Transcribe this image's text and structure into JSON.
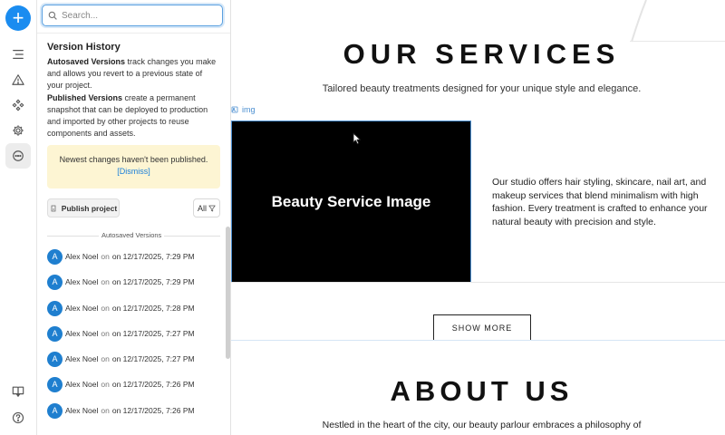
{
  "rail": {
    "add_label": "+"
  },
  "panel": {
    "search_placeholder": "Search...",
    "title": "Version History",
    "autosaved_term": "Autosaved Versions",
    "autosaved_desc": " track changes you make and allows you revert to a previous state of your project.",
    "published_term": "Published Versions",
    "published_desc": " create a permanent snapshot that can be deployed to production and imported by other projects to reuse components and assets.",
    "notice_text": "Newest changes haven't been published.",
    "notice_dismiss": "[Dismiss]",
    "publish_label": "Publish project",
    "filter_label": "All",
    "autosaved_section_label": "Autosaved Versions",
    "versions": [
      {
        "initial": "A",
        "author": "Alex Noel",
        "on": "on",
        "timestamp": "on 12/17/2025, 7:29 PM"
      },
      {
        "initial": "A",
        "author": "Alex Noel",
        "on": "on",
        "timestamp": "on 12/17/2025, 7:29 PM"
      },
      {
        "initial": "A",
        "author": "Alex Noel",
        "on": "on",
        "timestamp": "on 12/17/2025, 7:28 PM"
      },
      {
        "initial": "A",
        "author": "Alex Noel",
        "on": "on",
        "timestamp": "on 12/17/2025, 7:27 PM"
      },
      {
        "initial": "A",
        "author": "Alex Noel",
        "on": "on",
        "timestamp": "on 12/17/2025, 7:27 PM"
      },
      {
        "initial": "A",
        "author": "Alex Noel",
        "on": "on",
        "timestamp": "on 12/17/2025, 7:26 PM"
      },
      {
        "initial": "A",
        "author": "Alex Noel",
        "on": "on",
        "timestamp": "on 12/17/2025, 7:26 PM"
      }
    ]
  },
  "canvas": {
    "services_title": "OUR SERVICES",
    "services_subtitle": "Tailored beauty treatments designed for your unique style and elegance.",
    "img_tag": "img",
    "image_alt_text": "Beauty Service Image",
    "services_description": "Our studio offers hair styling, skincare, nail art, and makeup services that blend minimalism with high fashion. Every treatment is crafted to enhance your natural beauty with precision and style.",
    "show_more_label": "SHOW MORE",
    "about_title": "ABOUT US",
    "about_text": "Nestled in the heart of the city, our beauty parlour embraces a philosophy of"
  },
  "colors": {
    "accent": "#1a8cf0",
    "avatar": "#1f7fcf",
    "notice_bg": "#fdf5d3",
    "link": "#1a7fd9",
    "selection": "#4b8fd1"
  }
}
